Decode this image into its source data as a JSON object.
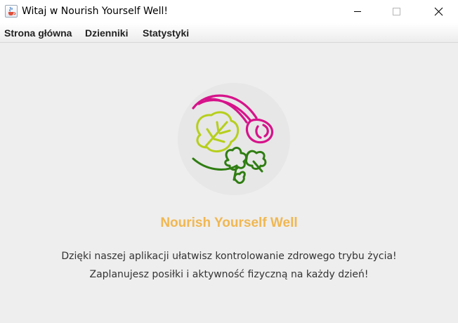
{
  "window": {
    "title": "Witaj w Nourish Yourself Well!"
  },
  "menu": {
    "items": [
      "Strona główna",
      "Dzienniki",
      "Statystyki"
    ]
  },
  "content": {
    "heading": "Nourish Yourself Well",
    "description_line1": "Dzięki naszej aplikacji ułatwisz kontrolowanie zdrowego trybu życia!",
    "description_line2": "Zaplanujesz posiłki i aktywność fizyczną na każdy dzień!"
  },
  "colors": {
    "heading": "#f0b752",
    "logo_beet": "#d6138a",
    "logo_leaf_light": "#b6cf1c",
    "logo_leaf_dark": "#2f7d12",
    "background": "#eeeeee"
  },
  "icons": {
    "app": "java-cup-icon",
    "minimize": "minimize-icon",
    "maximize": "maximize-icon",
    "close": "close-icon",
    "logo": "vegetables-logo"
  }
}
